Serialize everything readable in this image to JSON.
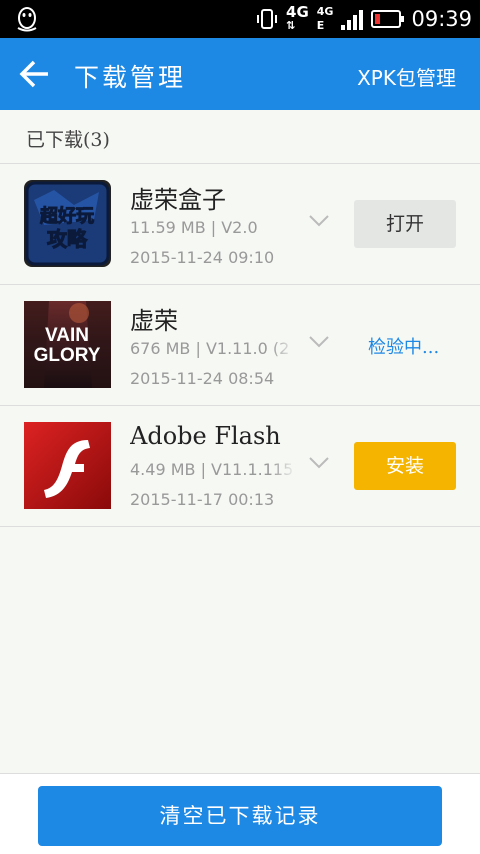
{
  "status_bar": {
    "left_icon": "qq-penguin-icon",
    "network_top": "4G",
    "network_second": "4G",
    "network_second_sub": "E",
    "time": "09:39"
  },
  "appbar": {
    "title": "下载管理",
    "xpk_link": "XPK包管理",
    "color": "#1e88e5"
  },
  "section": {
    "label": "已下载(3)"
  },
  "items": [
    {
      "name": "虚荣盒子",
      "size_version": "11.59 MB | V2.0",
      "date": "2015-11-24 09:10",
      "action": "打开",
      "icon_text": "超好玩攻略"
    },
    {
      "name": "虚荣",
      "size_version": "676 MB | V1.11.0 (2",
      "date": "2015-11-24 08:54",
      "action": "检验中...",
      "icon_text": "VAINGLORY"
    },
    {
      "name": "Adobe Flash P",
      "size_version": "4.49 MB | V11.1.115",
      "date": "2015-11-17 00:13",
      "action": "安装",
      "icon_text": "f"
    }
  ],
  "bottom": {
    "clear_label": "清空已下载记录"
  }
}
